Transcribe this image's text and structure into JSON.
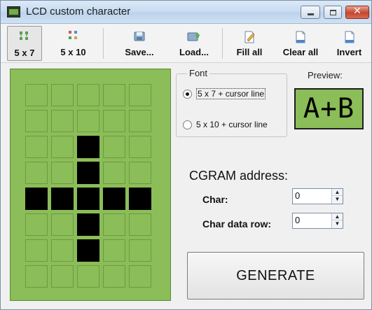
{
  "window": {
    "title": "LCD custom character",
    "close_glyph": "✕"
  },
  "toolbar": {
    "buttons": [
      {
        "label": "5 x 7",
        "icon": "grid-small-icon",
        "pressed": true
      },
      {
        "label": "5 x 10",
        "icon": "grid-large-icon",
        "pressed": false
      },
      {
        "label": "Save...",
        "icon": "save-icon",
        "pressed": false
      },
      {
        "label": "Load...",
        "icon": "load-icon",
        "pressed": false
      },
      {
        "label": "Fill all",
        "icon": "fill-all-icon",
        "pressed": false
      },
      {
        "label": "Clear all",
        "icon": "clear-all-icon",
        "pressed": false
      },
      {
        "label": "Invert",
        "icon": "invert-icon",
        "pressed": false
      }
    ]
  },
  "lcd": {
    "columns": 5,
    "rows": 8,
    "pixels": [
      [
        0,
        0,
        0,
        0,
        0
      ],
      [
        0,
        0,
        0,
        0,
        0
      ],
      [
        0,
        0,
        1,
        0,
        0
      ],
      [
        0,
        0,
        1,
        0,
        0
      ],
      [
        1,
        1,
        1,
        1,
        1
      ],
      [
        0,
        0,
        1,
        0,
        0
      ],
      [
        0,
        0,
        1,
        0,
        0
      ],
      [
        0,
        0,
        0,
        0,
        0
      ]
    ],
    "colors": {
      "background": "#8bbd58",
      "pixel_on": "#000000",
      "pixel_off_border": "#6c9a43"
    }
  },
  "font_group": {
    "title": "Font",
    "options": [
      {
        "label": "5 x 7 + cursor line",
        "checked": true
      },
      {
        "label": "5 x 10 + cursor line",
        "checked": false
      }
    ]
  },
  "preview": {
    "label": "Preview:",
    "text": "A+B"
  },
  "cgram": {
    "title": "CGRAM address:",
    "char_label": "Char:",
    "char_value": "0",
    "row_label": "Char data row:",
    "row_value": "0"
  },
  "generate": {
    "label": "GENERATE"
  }
}
